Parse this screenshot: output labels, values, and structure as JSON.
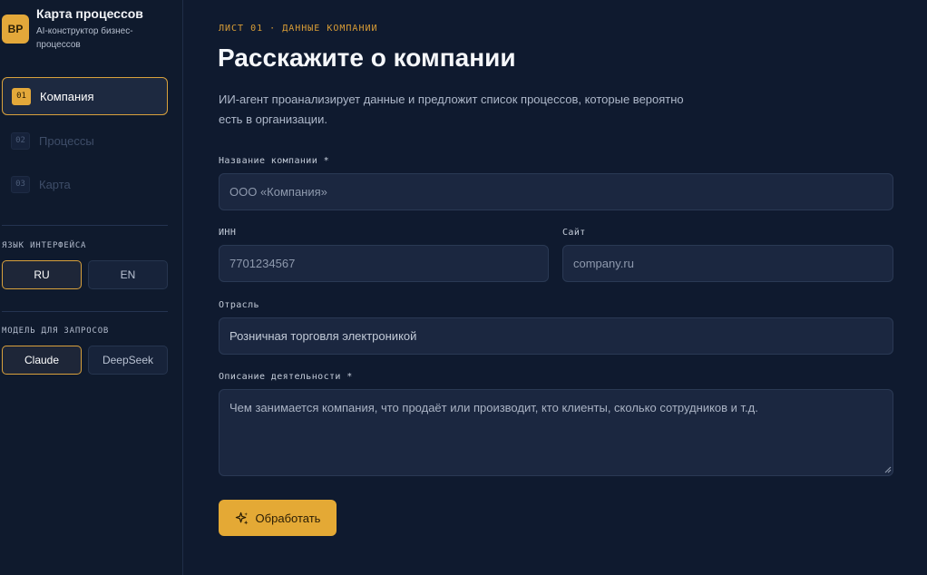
{
  "brand": {
    "logo": "BP",
    "title": "Карта процессов",
    "subtitle": "AI-конструктор бизнес-процессов"
  },
  "nav": {
    "items": [
      {
        "num": "01",
        "label": "Компания",
        "active": true
      },
      {
        "num": "02",
        "label": "Процессы",
        "active": false
      },
      {
        "num": "03",
        "label": "Карта",
        "active": false
      }
    ]
  },
  "language": {
    "label": "ЯЗЫК ИНТЕРФЕЙСА",
    "options": [
      "RU",
      "EN"
    ],
    "selected": "RU"
  },
  "model": {
    "label": "МОДЕЛЬ ДЛЯ ЗАПРОСОВ",
    "options": [
      "Claude",
      "DeepSeek"
    ],
    "selected": "Claude"
  },
  "main": {
    "eyebrow": "ЛИСТ 01 · ДАННЫЕ КОМПАНИИ",
    "title": "Расскажите о компании",
    "lead": "ИИ-агент проанализирует данные и предложит список процессов, которые вероятно есть в организации."
  },
  "form": {
    "company_name": {
      "label": "Название компании *",
      "placeholder": "ООО «Компания»",
      "value": ""
    },
    "inn": {
      "label": "ИНН",
      "placeholder": "7701234567",
      "value": ""
    },
    "site": {
      "label": "Сайт",
      "placeholder": "company.ru",
      "value": ""
    },
    "industry": {
      "label": "Отрасль",
      "placeholder": "",
      "value": "Розничная торговля электроникой"
    },
    "description": {
      "label": "Описание деятельности *",
      "placeholder": "Чем занимается компания, что продаёт или производит, кто клиенты, сколько сотрудников и т.д.",
      "value": ""
    },
    "submit_label": "Обработать"
  },
  "colors": {
    "accent": "#e4a935",
    "background": "#0f1a2f",
    "input_bg": "#1b2740"
  },
  "icons": {
    "submit": "sparkle-icon",
    "resize": "resize-handle-icon"
  }
}
